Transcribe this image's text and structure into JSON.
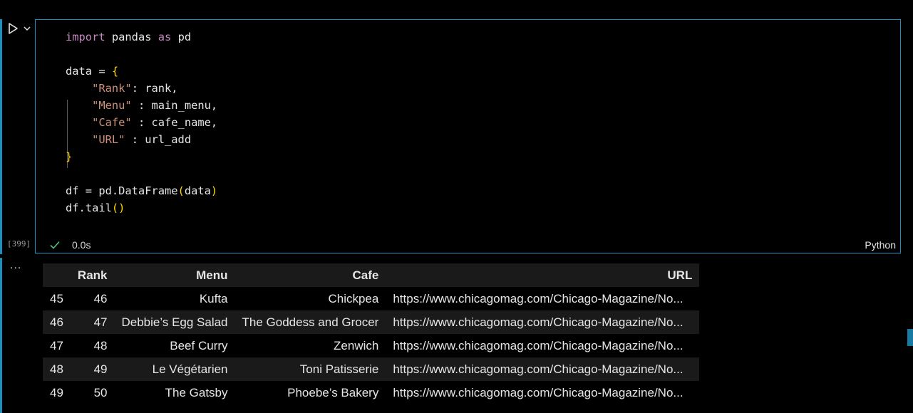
{
  "cell": {
    "execution_count": "[399]",
    "duration": "0.0s",
    "language": "Python",
    "code_lines": [
      "import pandas as pd",
      "",
      "data = {",
      "    \"Rank\": rank,",
      "    \"Menu\" : main_menu,",
      "    \"Cafe\" : cafe_name,",
      "    \"URL\" : url_add",
      "}",
      "",
      "df = pd.DataFrame(data)",
      "df.tail()"
    ]
  },
  "output": {
    "more_label": "...",
    "table": {
      "columns": [
        "",
        "Rank",
        "Menu",
        "Cafe",
        "URL"
      ],
      "rows": [
        {
          "index": "45",
          "rank": "46",
          "menu": "Kufta",
          "cafe": "Chickpea",
          "url": "https://www.chicagomag.com/Chicago-Magazine/No..."
        },
        {
          "index": "46",
          "rank": "47",
          "menu": "Debbie’s Egg Salad",
          "cafe": "The Goddess and Grocer",
          "url": "https://www.chicagomag.com/Chicago-Magazine/No..."
        },
        {
          "index": "47",
          "rank": "48",
          "menu": "Beef Curry",
          "cafe": "Zenwich",
          "url": "https://www.chicagomag.com/Chicago-Magazine/No..."
        },
        {
          "index": "48",
          "rank": "49",
          "menu": "Le Végétarien",
          "cafe": "Toni Patisserie",
          "url": "https://www.chicagomag.com/Chicago-Magazine/No..."
        },
        {
          "index": "49",
          "rank": "50",
          "menu": "The Gatsby",
          "cafe": "Phoebe’s Bakery",
          "url": "https://www.chicagomag.com/Chicago-Magazine/No..."
        }
      ]
    }
  },
  "colors": {
    "accent": "#1c8fbf",
    "keyword": "#c586c0",
    "string": "#ce9178",
    "bracket": "#ffd700",
    "success": "#4ec07a"
  },
  "icons": {
    "run": "run-cell-icon",
    "chevron": "chevron-down-icon",
    "check": "check-icon"
  }
}
